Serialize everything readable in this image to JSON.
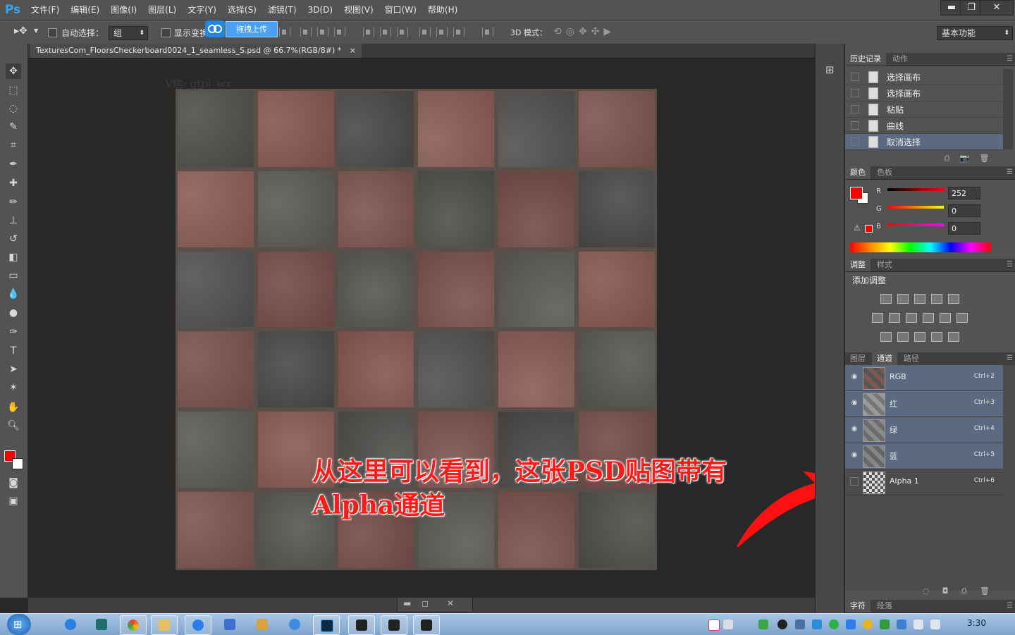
{
  "app": {
    "logo": "Ps"
  },
  "menu": [
    "文件(F)",
    "编辑(E)",
    "图像(I)",
    "图层(L)",
    "文字(Y)",
    "选择(S)",
    "滤镜(T)",
    "3D(D)",
    "视图(V)",
    "窗口(W)",
    "帮助(H)"
  ],
  "window_controls": {
    "minimize": "▬",
    "restore": "❐",
    "close": "✕"
  },
  "options": {
    "auto_select_label": "自动选择：",
    "auto_select_value": "组",
    "show_transform_label": "显示变换",
    "mode_3d_label": "3D 模式：",
    "workspace": "基本功能"
  },
  "baidu": {
    "upload_label": "拖拽上传"
  },
  "document": {
    "tab_title": "TexturesCom_FloorsCheckerboard0024_1_seamless_S.psd @ 66.7%(RGB/8#) *",
    "tab_close": "×"
  },
  "watermark": "V信: gtpl_wx",
  "annotation": {
    "line1": "从这里可以看到，这张PSD贴图带有",
    "line2": "Alpha通道"
  },
  "history_panel": {
    "tabs": [
      "历史记录",
      "动作"
    ],
    "rows": [
      "选择画布",
      "选择画布",
      "粘贴",
      "曲线",
      "取消选择"
    ],
    "active_index": 4
  },
  "color_panel": {
    "tabs": [
      "颜色",
      "色板"
    ],
    "fg_color": "#fc0000",
    "channels": [
      {
        "label": "R",
        "value": "252"
      },
      {
        "label": "G",
        "value": "0"
      },
      {
        "label": "B",
        "value": "0"
      }
    ]
  },
  "adjust_panel": {
    "tabs": [
      "调整",
      "样式"
    ],
    "title": "添加调整"
  },
  "layers_panel": {
    "tabs": [
      "图层",
      "通道",
      "路径"
    ],
    "active_tab": "通道",
    "channels": [
      {
        "name": "RGB",
        "shortcut": "Ctrl+2"
      },
      {
        "name": "红",
        "shortcut": "Ctrl+3"
      },
      {
        "name": "绿",
        "shortcut": "Ctrl+4"
      },
      {
        "name": "蓝",
        "shortcut": "Ctrl+5"
      },
      {
        "name": "Alpha 1",
        "shortcut": "Ctrl+6"
      }
    ]
  },
  "bottom_panel": {
    "tabs": [
      "字符",
      "段落"
    ]
  },
  "taskbar": {
    "clock": "3:30"
  },
  "colors": {
    "accent": "#30a6f2",
    "annotation": "#ff1a1a",
    "selected_row": "#5b6a80"
  }
}
